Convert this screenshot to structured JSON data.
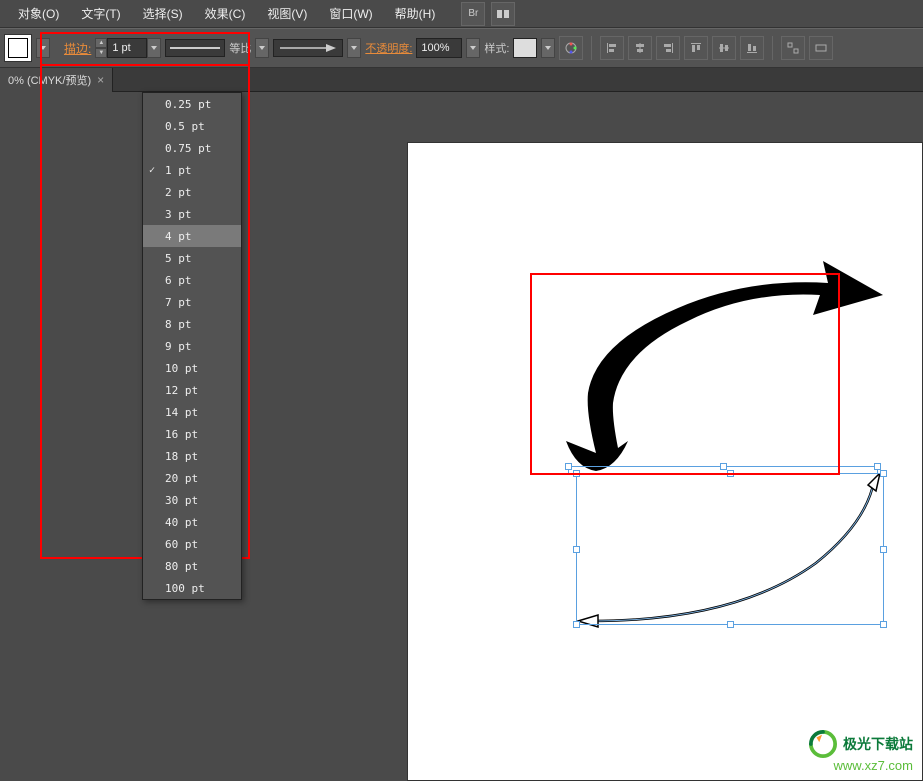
{
  "menubar": {
    "items": [
      {
        "label": "对象(O)"
      },
      {
        "label": "文字(T)"
      },
      {
        "label": "选择(S)"
      },
      {
        "label": "效果(C)"
      },
      {
        "label": "视图(V)"
      },
      {
        "label": "窗口(W)"
      },
      {
        "label": "帮助(H)"
      }
    ],
    "br_label": "Br"
  },
  "toolbar": {
    "stroke_label": "描边:",
    "stroke_value": "1 pt",
    "equal_label": "等比",
    "opacity_label": "不透明度:",
    "opacity_value": "100%",
    "style_label": "样式:"
  },
  "tab": {
    "title": "0% (CMYK/预览)",
    "close": "×"
  },
  "stroke_menu": {
    "items": [
      {
        "label": "0.25 pt",
        "selected": false,
        "highlight": false
      },
      {
        "label": "0.5 pt",
        "selected": false,
        "highlight": false
      },
      {
        "label": "0.75 pt",
        "selected": false,
        "highlight": false
      },
      {
        "label": "1 pt",
        "selected": true,
        "highlight": false
      },
      {
        "label": "2 pt",
        "selected": false,
        "highlight": false
      },
      {
        "label": "3 pt",
        "selected": false,
        "highlight": false
      },
      {
        "label": "4 pt",
        "selected": false,
        "highlight": true
      },
      {
        "label": "5 pt",
        "selected": false,
        "highlight": false
      },
      {
        "label": "6 pt",
        "selected": false,
        "highlight": false
      },
      {
        "label": "7 pt",
        "selected": false,
        "highlight": false
      },
      {
        "label": "8 pt",
        "selected": false,
        "highlight": false
      },
      {
        "label": "9 pt",
        "selected": false,
        "highlight": false
      },
      {
        "label": "10 pt",
        "selected": false,
        "highlight": false
      },
      {
        "label": "12 pt",
        "selected": false,
        "highlight": false
      },
      {
        "label": "14 pt",
        "selected": false,
        "highlight": false
      },
      {
        "label": "16 pt",
        "selected": false,
        "highlight": false
      },
      {
        "label": "18 pt",
        "selected": false,
        "highlight": false
      },
      {
        "label": "20 pt",
        "selected": false,
        "highlight": false
      },
      {
        "label": "30 pt",
        "selected": false,
        "highlight": false
      },
      {
        "label": "40 pt",
        "selected": false,
        "highlight": false
      },
      {
        "label": "60 pt",
        "selected": false,
        "highlight": false
      },
      {
        "label": "80 pt",
        "selected": false,
        "highlight": false
      },
      {
        "label": "100 pt",
        "selected": false,
        "highlight": false
      }
    ]
  },
  "watermark": {
    "line1": "极光下载站",
    "line2": "www.xz7.com"
  }
}
